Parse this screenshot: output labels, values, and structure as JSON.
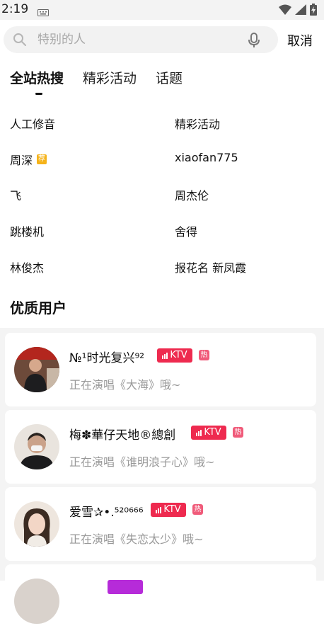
{
  "status_bar": {
    "time": "2:19"
  },
  "search": {
    "placeholder": "特别的人",
    "cancel_label": "取消"
  },
  "tabs": [
    {
      "label": "全站热搜",
      "active": true
    },
    {
      "label": "精彩活动",
      "active": false
    },
    {
      "label": "话题",
      "active": false
    }
  ],
  "hot_search": [
    {
      "label": "人工修音"
    },
    {
      "label": "精彩活动"
    },
    {
      "label": "周深",
      "badge": "荐"
    },
    {
      "label": "xiaofan775"
    },
    {
      "label": "飞"
    },
    {
      "label": "周杰伦"
    },
    {
      "label": "跳楼机"
    },
    {
      "label": "舍得"
    },
    {
      "label": "林俊杰"
    },
    {
      "label": "报花名 新凤霞"
    }
  ],
  "quality_users": {
    "title": "优质用户",
    "users": [
      {
        "name": "№¹时光复兴⁹²",
        "ktv_label": "KTV",
        "hot_label": "热",
        "status": "正在演唱《大海》哦~"
      },
      {
        "name": "梅✽華仔天地®總創",
        "ktv_label": "KTV",
        "hot_label": "热",
        "status": "正在演唱《谁明浪子心》哦~"
      },
      {
        "name": "爱雪✰•.⁵²⁰⁶⁶⁶",
        "ktv_label": "KTV",
        "hot_label": "热",
        "status": "正在演唱《失恋太少》哦~"
      }
    ]
  },
  "colors": {
    "ktv": "#ee2a4f",
    "hot": "#f05b7a",
    "recommend": "#f5b31a"
  }
}
